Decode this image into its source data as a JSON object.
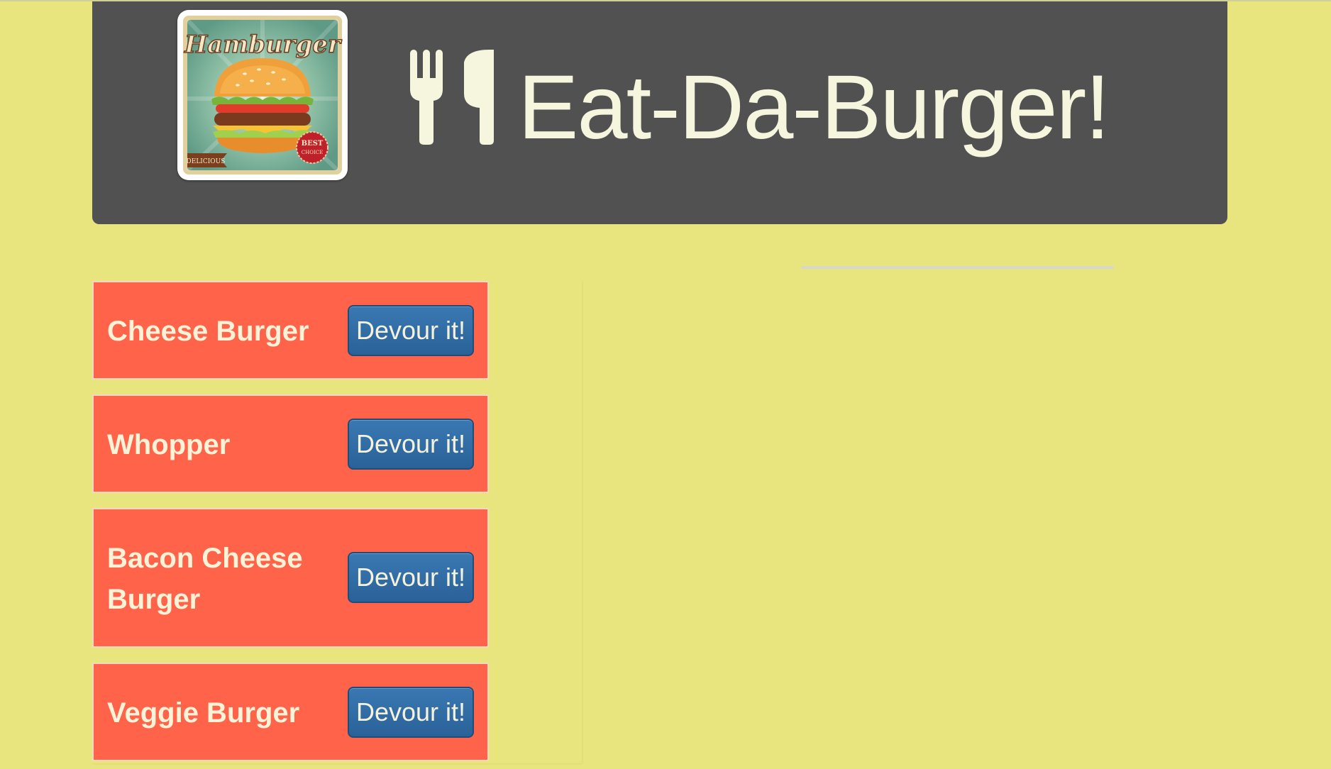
{
  "header": {
    "title": "Eat-Da-Burger!",
    "logo": {
      "script_text": "Hamburger",
      "ribbon_text": "DELICIOUS",
      "badge_line1": "BEST",
      "badge_line2": "CHOICE"
    },
    "icon": "utensils-icon"
  },
  "burgers": [
    {
      "name": "Cheese Burger",
      "button_label": "Devour it!"
    },
    {
      "name": "Whopper",
      "button_label": "Devour it!"
    },
    {
      "name": "Bacon Cheese Burger",
      "button_label": "Devour it!"
    },
    {
      "name": "Veggie Burger",
      "button_label": "Devour it!"
    }
  ],
  "colors": {
    "page_background": "#e8e57f",
    "header_background": "#515151",
    "title_color": "#f6f5dd",
    "card_background": "#ff634a",
    "button_background": "#2f6aa3"
  }
}
